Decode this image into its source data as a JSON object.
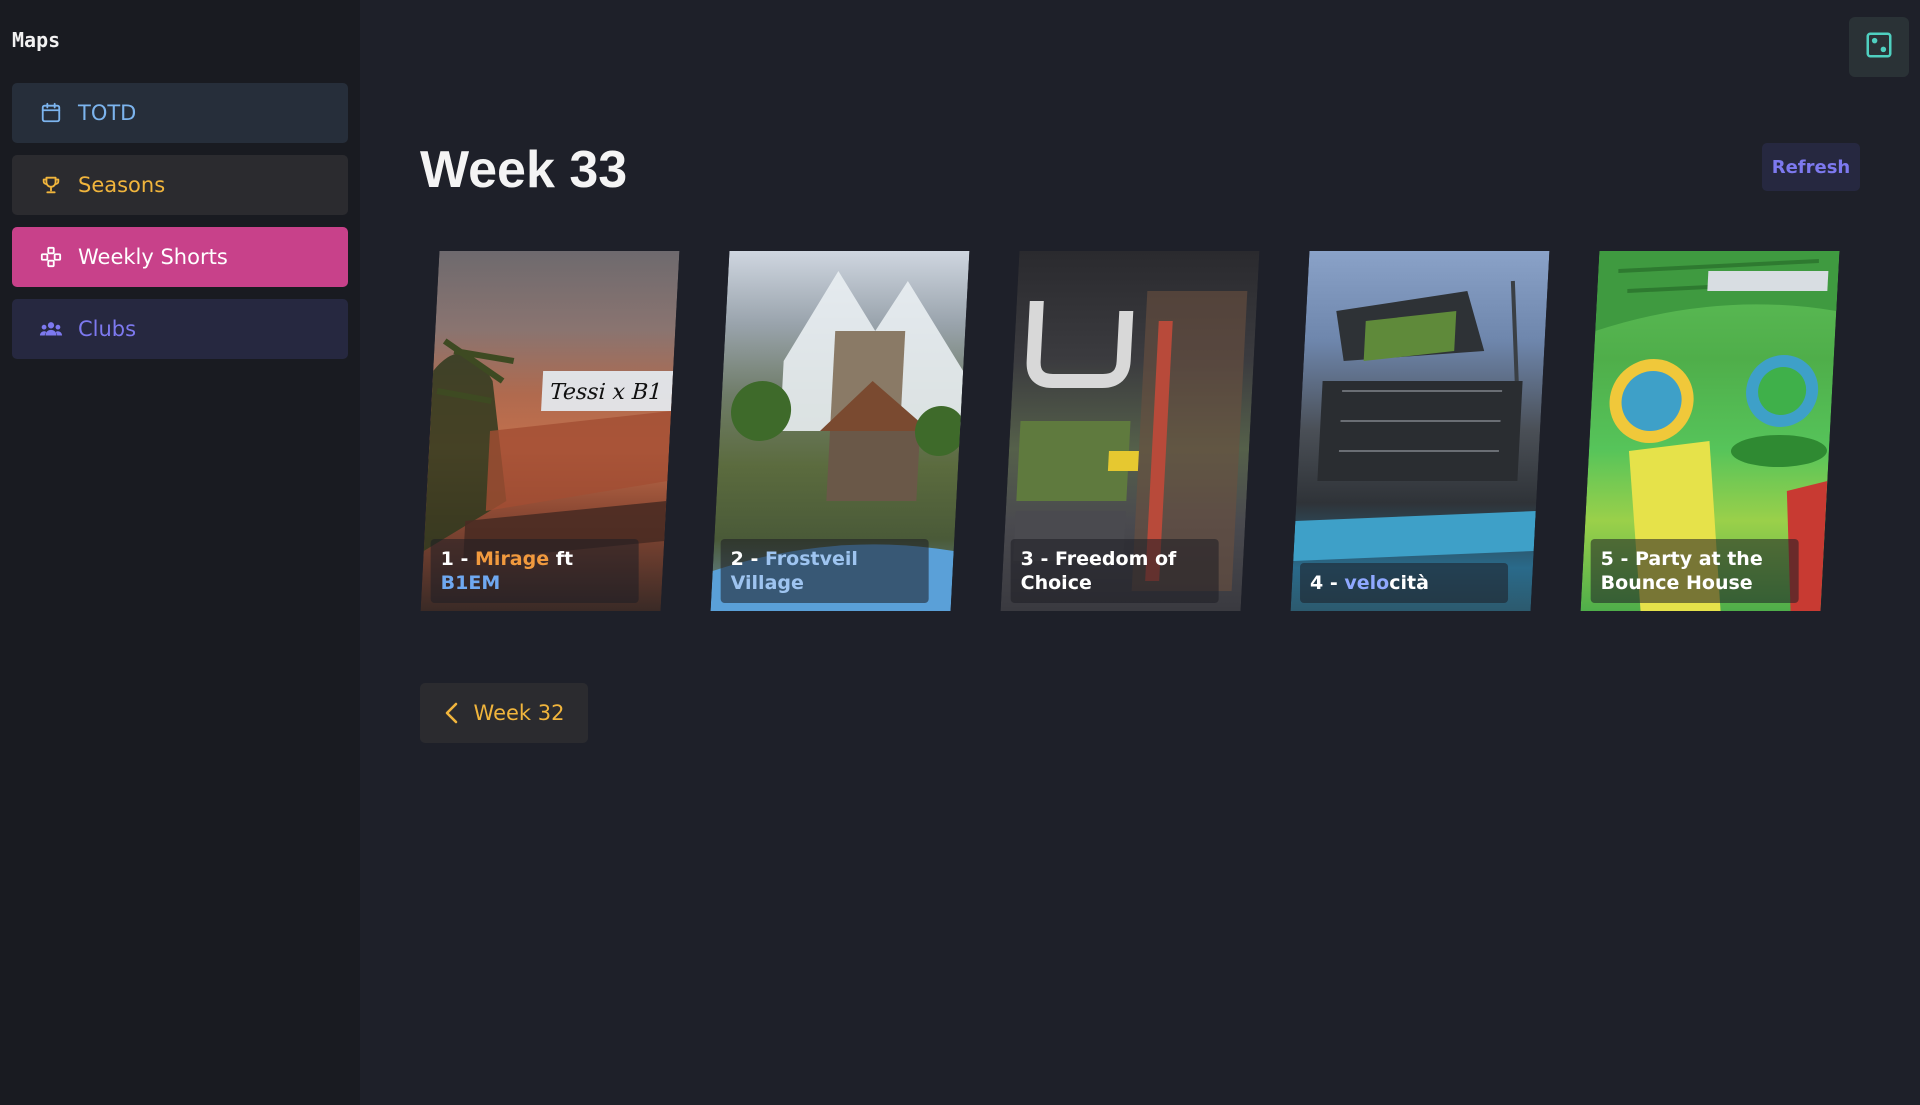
{
  "sidebar": {
    "title": "Maps",
    "items": [
      {
        "label": "TOTD",
        "icon": "calendar-icon",
        "color": "#7cb4ee"
      },
      {
        "label": "Seasons",
        "icon": "trophy-icon",
        "color": "#f1b53c"
      },
      {
        "label": "Weekly Shorts",
        "icon": "shorts-icon",
        "color": "#ffffff",
        "active": true
      },
      {
        "label": "Clubs",
        "icon": "users-icon",
        "color": "#7d79ef"
      }
    ]
  },
  "header": {
    "title": "Week 33",
    "refresh_label": "Refresh",
    "dice_icon": "dice-icon"
  },
  "maps": [
    {
      "num": "1",
      "sep": " - ",
      "name_parts": [
        {
          "text": "Mirage",
          "color": "#f19a3e"
        },
        {
          "text": " ft ",
          "color": "#ffffff"
        },
        {
          "text": "B1EM",
          "color": "#6fa8f0"
        }
      ]
    },
    {
      "num": "2",
      "sep": " - ",
      "name_parts": [
        {
          "text": "Frostveil Village",
          "color": "#9ec4f0"
        }
      ]
    },
    {
      "num": "3",
      "sep": " - ",
      "name_parts": [
        {
          "text": "Freedom of Choice",
          "color": "#ffffff"
        }
      ]
    },
    {
      "num": "4",
      "sep": " - ",
      "name_parts": [
        {
          "text": "velo",
          "color": "#8fa8ff"
        },
        {
          "text": "cità",
          "color": "#ffffff"
        }
      ]
    },
    {
      "num": "5",
      "sep": " - ",
      "name_parts": [
        {
          "text": "Party at the Bounce House",
          "color": "#ffffff"
        }
      ]
    }
  ],
  "navigation": {
    "prev_label": "Week 32"
  },
  "colors": {
    "background": "#1e2029",
    "sidebar": "#191b21",
    "accent_pink": "#c8418a",
    "accent_gold": "#f1b53c",
    "accent_blue": "#7cb4ee",
    "accent_purple": "#7d79ef"
  }
}
